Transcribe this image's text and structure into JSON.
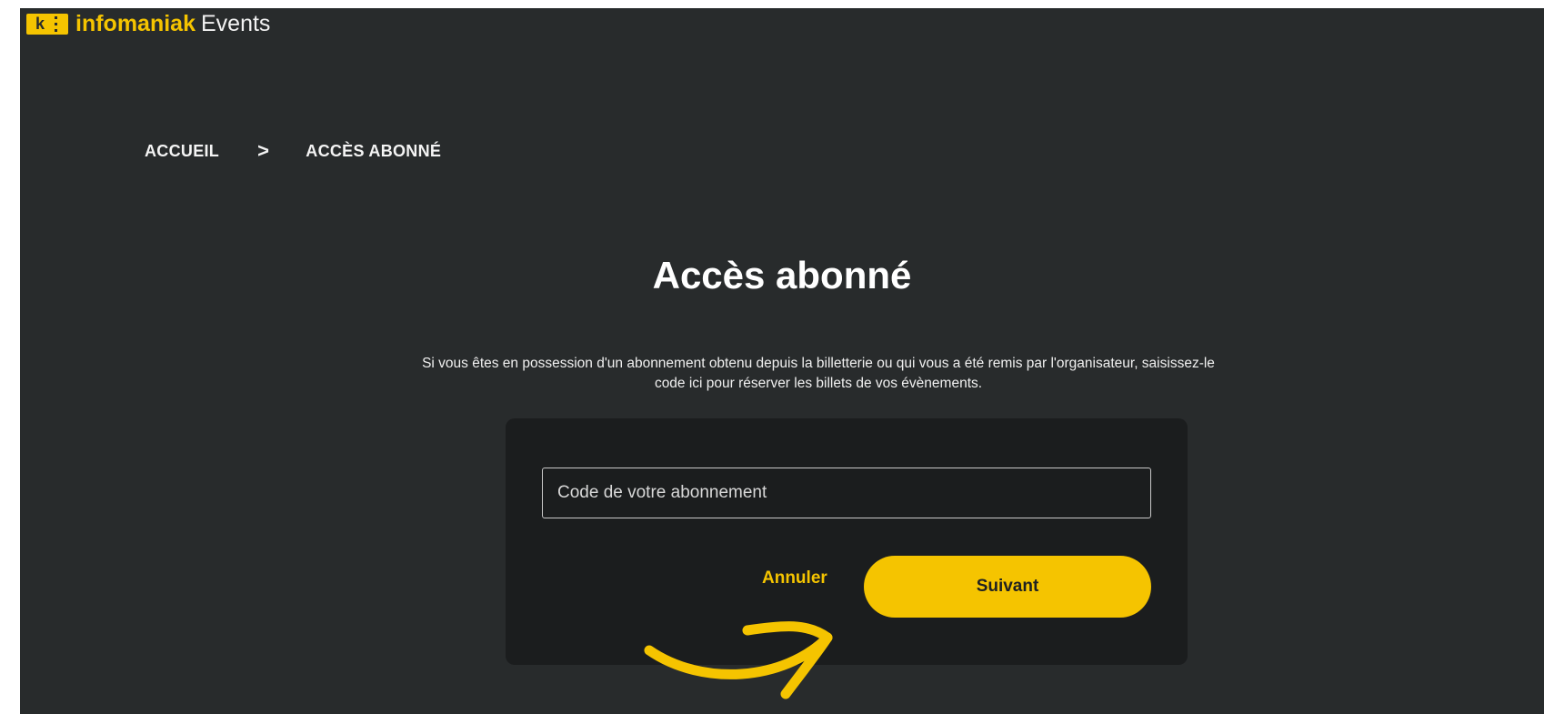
{
  "brand": {
    "name": "infomaniak",
    "product": "Events",
    "logo_letter": "k"
  },
  "breadcrumb": {
    "home": "ACCUEIL",
    "separator": ">",
    "current": "ACCÈS ABONNÉ"
  },
  "page": {
    "title": "Accès abonné",
    "description": "Si vous êtes en possession d'un abonnement obtenu depuis la billetterie ou qui vous a été remis par l'organisateur, saisissez-le code ici pour réserver les billets de vos évènements."
  },
  "form": {
    "code_placeholder": "Code de votre abonnement",
    "code_value": "",
    "cancel_label": "Annuler",
    "next_label": "Suivant"
  },
  "colors": {
    "accent": "#f5c400",
    "background": "#282b2c",
    "card": "#1b1d1e"
  },
  "annotation": {
    "icon": "curved-arrow-icon"
  }
}
